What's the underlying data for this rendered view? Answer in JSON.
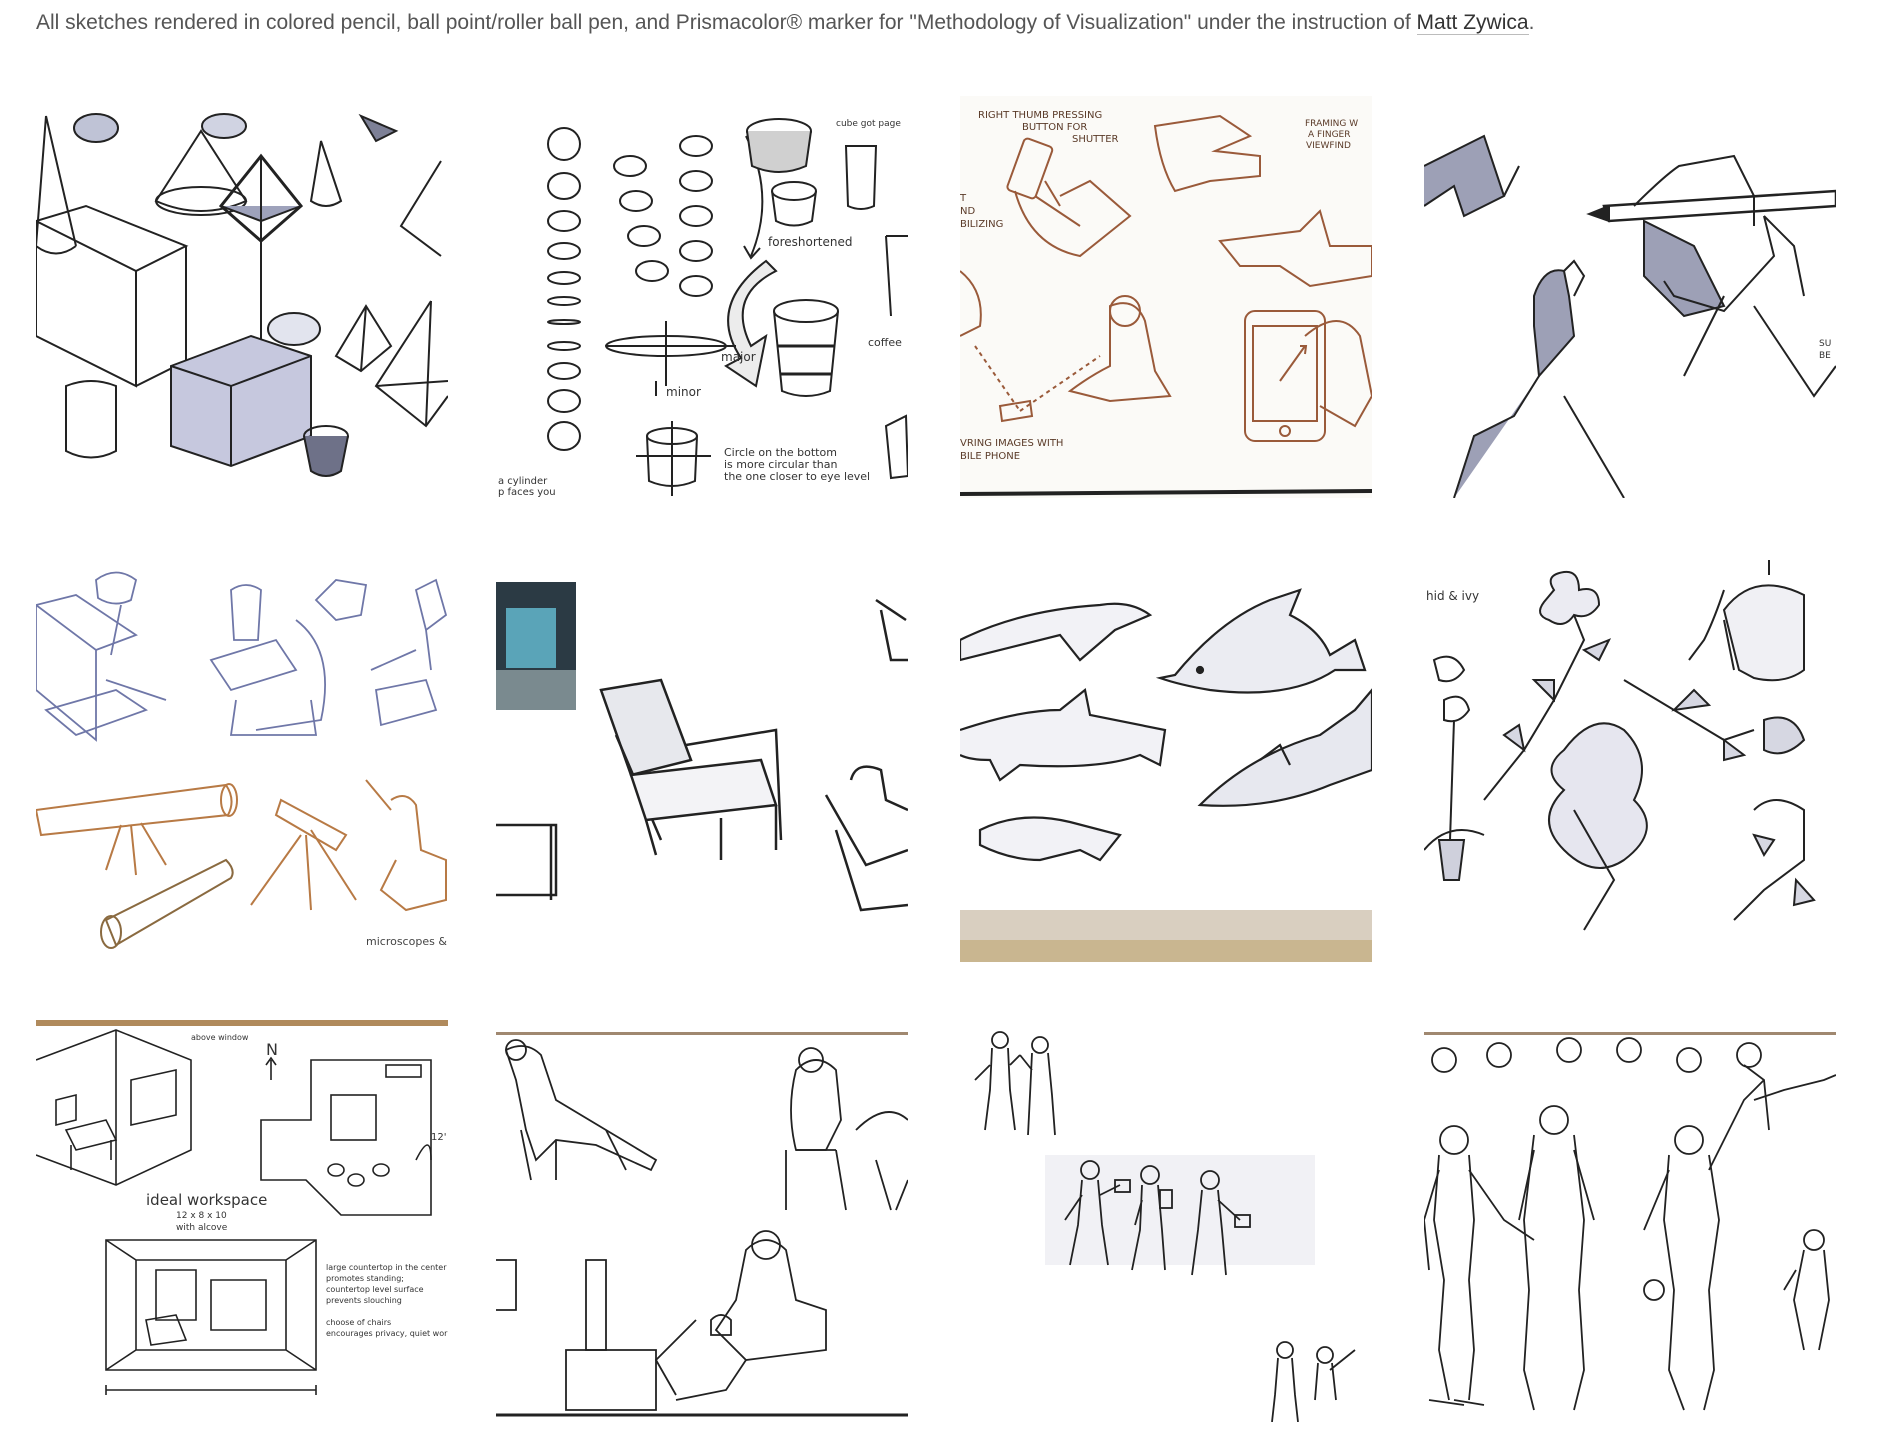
{
  "caption": {
    "prefix": "All sketches rendered in colored pencil, ball point/roller ball pen, and Prismacolor® marker for \"Methodology of Visualization\" under the instruction of ",
    "link_text": "Matt Zywica",
    "suffix": "."
  },
  "sketches": [
    {
      "subject": "geometric-forms",
      "notes": []
    },
    {
      "subject": "ellipses-and-cups",
      "notes": [
        "cube got page",
        "foreshortened",
        "major",
        "minor",
        "coffee",
        "Circle on the bottom",
        "is more circular than",
        "the one closer to eye level",
        "a cylinder",
        "p faces you"
      ]
    },
    {
      "subject": "hands-holding-phone",
      "notes": [
        "RIGHT THUMB PRESSING",
        "BUTTON FOR",
        "SHUTTER",
        "FRAMING W",
        "A FINGER",
        "VIEWFIND",
        "T",
        "ND",
        "BILIZING",
        "VRING IMAGES WITH",
        "BILE PHONE"
      ]
    },
    {
      "subject": "hand-holding-pen",
      "notes": [
        "SU",
        "BE"
      ]
    },
    {
      "subject": "microscopes-and-telescopes",
      "notes": [
        "microscopes & tel"
      ]
    },
    {
      "subject": "armchairs",
      "notes": []
    },
    {
      "subject": "dolphins",
      "notes": []
    },
    {
      "subject": "orchid-and-ivy",
      "notes": [
        "hid & ivy"
      ]
    },
    {
      "subject": "ideal-workspace",
      "notes": [
        "N",
        "ideal workspace",
        "12 x 8 x 10",
        "with alcove",
        "12'",
        "large countertop in the center",
        "promotes standing;",
        "countertop level surface",
        "prevents slouching",
        "choose of chairs",
        "encourages privacy, quiet work"
      ]
    },
    {
      "subject": "seated-figures",
      "notes": []
    },
    {
      "subject": "figure-poses",
      "notes": []
    },
    {
      "subject": "robot-figures",
      "notes": []
    }
  ]
}
